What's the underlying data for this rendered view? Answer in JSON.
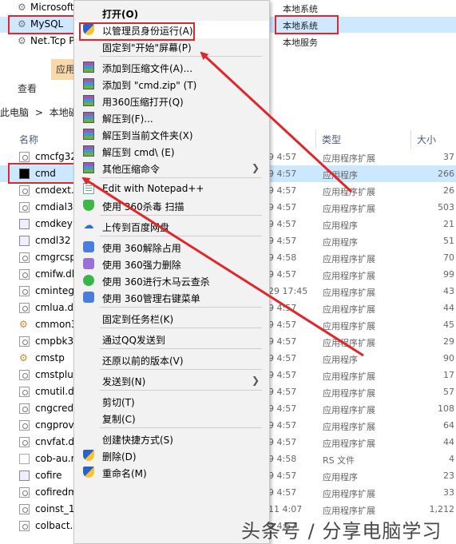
{
  "services": [
    {
      "name": "Microsoft",
      "type": "本地系统"
    },
    {
      "name": "MySQL",
      "type": "本地系统",
      "selected": true
    },
    {
      "name": "Net.Tcp Port",
      "type": "本地服务"
    }
  ],
  "ribbon": {
    "app_tab": "应用",
    "view_tab": "查看"
  },
  "breadcrumb": {
    "this_pc": "此电脑",
    "sep": ">",
    "local_disk": "本地磁"
  },
  "columns": {
    "name": "名称",
    "type": "类型",
    "size": "大小"
  },
  "files": [
    {
      "name": "cmcfg32",
      "date": "9 4:57",
      "type": "应用程序扩展",
      "size": "37",
      "icon": "dll"
    },
    {
      "name": "cmd",
      "date": "9 4:57",
      "type": "应用程序",
      "size": "266",
      "icon": "cmd",
      "selected": true
    },
    {
      "name": "cmdext.d",
      "date": "9 4:57",
      "type": "应用程序扩展",
      "size": "26",
      "icon": "dll"
    },
    {
      "name": "cmdial32",
      "date": "9 4:57",
      "type": "应用程序扩展",
      "size": "503",
      "icon": "dll"
    },
    {
      "name": "cmdkey",
      "date": "9 4:57",
      "type": "应用程序",
      "size": "21",
      "icon": "exe"
    },
    {
      "name": "cmdl32",
      "date": "9 4:57",
      "type": "应用程序",
      "size": "51",
      "icon": "exe"
    },
    {
      "name": "cmgrcspr",
      "date": "9 4:58",
      "type": "应用程序扩展",
      "size": "70",
      "icon": "dll"
    },
    {
      "name": "cmifw.dl",
      "date": "9 4:57",
      "type": "应用程序扩展",
      "size": "99",
      "icon": "dll"
    },
    {
      "name": "cminteg",
      "date": "29 17:45",
      "type": "应用程序扩展",
      "size": "43",
      "icon": "dll"
    },
    {
      "name": "cmlua.dl",
      "date": "9 4:57",
      "type": "应用程序扩展",
      "size": "44",
      "icon": "dll"
    },
    {
      "name": "cmmon3",
      "date": "9 4:57",
      "type": "应用程序扩展",
      "size": "45",
      "icon": "gear"
    },
    {
      "name": "cmpbk3",
      "date": "9 4:57",
      "type": "应用程序扩展",
      "size": "29",
      "icon": "dll"
    },
    {
      "name": "cmstp",
      "date": "9 4:57",
      "type": "应用程序",
      "size": "90",
      "icon": "gear"
    },
    {
      "name": "cmstplua",
      "date": "9 4:57",
      "type": "应用程序扩展",
      "size": "17",
      "icon": "dll"
    },
    {
      "name": "cmutil.dl",
      "date": "9 4:57",
      "type": "应用程序扩展",
      "size": "57",
      "icon": "dll"
    },
    {
      "name": "cngcred",
      "date": "9 4:57",
      "type": "应用程序扩展",
      "size": "108",
      "icon": "dll"
    },
    {
      "name": "cngprov",
      "date": "9 4:57",
      "type": "应用程序扩展",
      "size": "64",
      "icon": "dll"
    },
    {
      "name": "cnvfat.dl",
      "date": "9 4:57",
      "type": "应用程序扩展",
      "size": "44",
      "icon": "dll"
    },
    {
      "name": "cob-au.r",
      "date": "9 4:58",
      "type": "RS 文件",
      "size": "4",
      "icon": "page"
    },
    {
      "name": "cofire",
      "date": "9 4:57",
      "type": "应用程序",
      "size": "23",
      "icon": "exe"
    },
    {
      "name": "cofiredm",
      "date": "9 4:57",
      "type": "应用程序扩展",
      "size": "33",
      "icon": "dll"
    },
    {
      "name": "coinst_11",
      "date": "11 4:07",
      "type": "应用程序扩展",
      "size": "1,212",
      "icon": "dll"
    },
    {
      "name": "colbact.d",
      "date": "9 4:57",
      "type": "",
      "size": "",
      "icon": "dll"
    }
  ],
  "context_menu": {
    "items": [
      {
        "label": "打开(O)",
        "bold": true,
        "icon": "",
        "submenu": false
      },
      {
        "label": "以管理员身份运行(A)",
        "icon": "uac-shield-icon",
        "submenu": false,
        "highlighted": true
      },
      {
        "label": "固定到\"开始\"屏幕(P)",
        "icon": "",
        "submenu": false
      },
      {
        "sep": true
      },
      {
        "label": "添加到压缩文件(A)...",
        "icon": "winrar-icon",
        "submenu": false
      },
      {
        "label": "添加到 \"cmd.zip\" (T)",
        "icon": "winrar-icon",
        "submenu": false
      },
      {
        "label": "用360压缩打开(Q)",
        "icon": "winrar-icon",
        "submenu": false
      },
      {
        "label": "解压到(F)...",
        "icon": "winrar-icon",
        "submenu": false
      },
      {
        "label": "解压到当前文件夹(X)",
        "icon": "winrar-icon",
        "submenu": false
      },
      {
        "label": "解压到 cmd\\ (E)",
        "icon": "winrar-icon",
        "submenu": false
      },
      {
        "label": "其他压缩命令",
        "icon": "winrar-icon",
        "submenu": true
      },
      {
        "sep": true
      },
      {
        "label": "Edit with Notepad++",
        "icon": "notepad-icon",
        "submenu": false
      },
      {
        "label": "使用 360杀毒 扫描",
        "icon": "360-antivirus-icon",
        "submenu": false
      },
      {
        "sep": true
      },
      {
        "label": "上传到百度网盘",
        "icon": "baidu-netdisk-icon",
        "submenu": false
      },
      {
        "sep": true
      },
      {
        "label": "使用 360解除占用",
        "icon": "360-unlock-icon",
        "submenu": false
      },
      {
        "label": "使用 360强力删除",
        "icon": "360-delete-icon",
        "submenu": false
      },
      {
        "label": "使用 360进行木马云查杀",
        "icon": "360-trojan-icon",
        "submenu": false
      },
      {
        "label": "使用 360管理右键菜单",
        "icon": "360-menu-icon",
        "submenu": false
      },
      {
        "sep": true
      },
      {
        "label": "固定到任务栏(K)",
        "icon": "",
        "submenu": false
      },
      {
        "sep": true
      },
      {
        "label": "通过QQ发送到",
        "icon": "",
        "submenu": false
      },
      {
        "sep": true
      },
      {
        "label": "还原以前的版本(V)",
        "icon": "",
        "submenu": false
      },
      {
        "sep": true
      },
      {
        "label": "发送到(N)",
        "icon": "",
        "submenu": true
      },
      {
        "sep": true
      },
      {
        "label": "剪切(T)",
        "icon": "",
        "submenu": false
      },
      {
        "label": "复制(C)",
        "icon": "",
        "submenu": false
      },
      {
        "sep": true
      },
      {
        "label": "创建快捷方式(S)",
        "icon": "",
        "submenu": false
      },
      {
        "label": "删除(D)",
        "icon": "uac-shield-icon",
        "submenu": false
      },
      {
        "label": "重命名(M)",
        "icon": "uac-shield-icon",
        "submenu": false
      }
    ]
  },
  "annotation": {
    "color": "#e0262a"
  },
  "watermark": "头条号 / 分享电脑学习"
}
